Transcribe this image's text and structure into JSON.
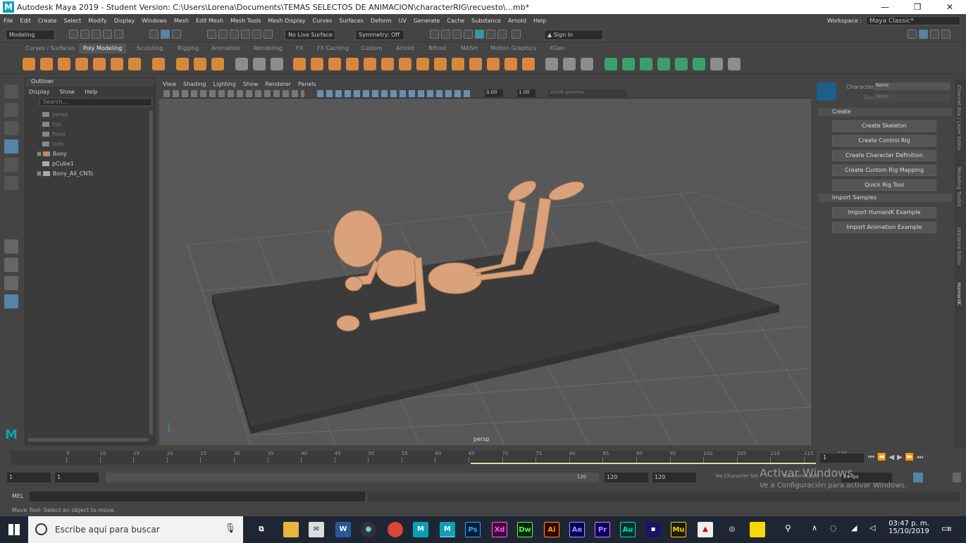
{
  "window": {
    "title": "Autodesk Maya 2019 - Student Version: C:\\Users\\Lorena\\Documents\\TEMAS SELECTOS DE ANIMACION\\characterRIG\\recuesto\\...mb*"
  },
  "menu": [
    "File",
    "Edit",
    "Create",
    "Select",
    "Modify",
    "Display",
    "Windows",
    "Mesh",
    "Edit Mesh",
    "Mesh Tools",
    "Mesh Display",
    "Curves",
    "Surfaces",
    "Deform",
    "UV",
    "Generate",
    "Cache",
    "Substance",
    "Arnold",
    "Help"
  ],
  "workspace": {
    "label": "Workspace :",
    "value": "Maya Classic*"
  },
  "statusline": {
    "mode": "Modeling",
    "live_surface": "No Live Surface",
    "symmetry": "Symmetry: Off",
    "sign_in": "Sign In"
  },
  "shelf_tabs": [
    "Curves / Surfaces",
    "Poly Modeling",
    "Sculpting",
    "Rigging",
    "Animation",
    "Rendering",
    "FX",
    "FX Caching",
    "Custom",
    "Arnold",
    "Bifrost",
    "MASH",
    "Motion Graphics",
    "XGen"
  ],
  "outliner": {
    "title": "Outliner",
    "menu": [
      "Display",
      "Show",
      "Help"
    ],
    "search_placeholder": "Search...",
    "items": [
      "persp",
      "top",
      "front",
      "side",
      "Bony",
      "pCube1",
      "Bony_All_CNTs"
    ]
  },
  "viewport": {
    "menu": [
      "View",
      "Shading",
      "Lighting",
      "Show",
      "Renderer",
      "Panels"
    ],
    "gamma_value": "0.00",
    "exposure_value": "1.00",
    "color_space": "sRGB gamma",
    "camera_label": "persp"
  },
  "hik": {
    "character_label": "Character:",
    "character_value": "None",
    "source_label": "Source:",
    "source_value": "None",
    "create_title": "Create",
    "create_buttons": [
      "Create Skeleton",
      "Create Control Rig",
      "Create Character Definition",
      "Create Custom Rig Mapping",
      "Quick Rig Tool"
    ],
    "samples_title": "Import Samples",
    "sample_buttons": [
      "Import HumanIK Example",
      "Import Animation Example"
    ]
  },
  "side_tabs": [
    "Channel Box / Layer Editor",
    "Modeling Toolkit",
    "Attribute Editor",
    "HumanIK"
  ],
  "timeline": {
    "ticks": [
      "5",
      "10",
      "15",
      "20",
      "25",
      "30",
      "35",
      "40",
      "45",
      "50",
      "55",
      "60",
      "65",
      "70",
      "75",
      "80",
      "85",
      "90",
      "95",
      "100",
      "105",
      "110",
      "115",
      "120"
    ],
    "current_frame": "1"
  },
  "range": {
    "start": "1",
    "start2": "1",
    "end_inner": "120",
    "end": "120",
    "end2": "120",
    "no_char": "No Character Set",
    "no_anim": "No Anim Layer",
    "fps": "24 fps"
  },
  "cmd": {
    "label": "MEL"
  },
  "help": {
    "text": "Move Tool: Select an object to move."
  },
  "activate": {
    "line1": "Activar Windows",
    "line2": "Ve a Configuración para activar Windows."
  },
  "taskbar": {
    "search": "Escribe aquí para buscar",
    "time": "03:47 p. m.",
    "date": "15/10/2019",
    "notif": "8"
  },
  "colors": {
    "bg": "#444444",
    "viewport": "#585858",
    "plane": "#3b3b3b",
    "character": "#d9a27a",
    "accent": "#5285a6"
  }
}
